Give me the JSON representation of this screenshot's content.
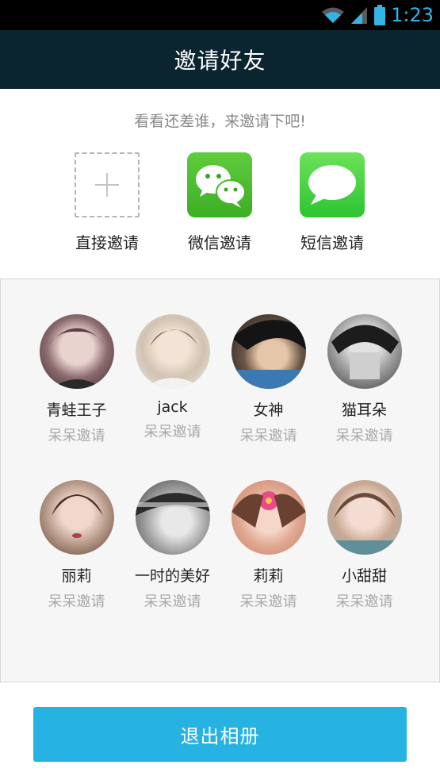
{
  "status_bar": {
    "time": "1:23",
    "icons": [
      "wifi-icon",
      "signal-icon",
      "battery-icon"
    ],
    "accent_color": "#33b5e5"
  },
  "header": {
    "title": "邀请好友",
    "background": "#0a2530"
  },
  "invite": {
    "hint": "看看还差谁，来邀请下吧!",
    "options": [
      {
        "label": "直接邀请",
        "icon": "plus-icon"
      },
      {
        "label": "微信邀请",
        "icon": "wechat-icon",
        "color": "#45b92c"
      },
      {
        "label": "短信邀请",
        "icon": "message-bubble-icon",
        "color": "#3ccf3b"
      }
    ]
  },
  "friends": [
    {
      "name": "青蛙王子",
      "status": "呆呆邀请",
      "avatar": "avatar-photo"
    },
    {
      "name": "jack",
      "status": "呆呆邀请",
      "avatar": "avatar-photo"
    },
    {
      "name": "女神",
      "status": "呆呆邀请",
      "avatar": "avatar-photo"
    },
    {
      "name": "猫耳朵",
      "status": "呆呆邀请",
      "avatar": "avatar-photo"
    },
    {
      "name": "丽莉",
      "status": "呆呆邀请",
      "avatar": "avatar-photo"
    },
    {
      "name": "一时的美好",
      "status": "呆呆邀请",
      "avatar": "avatar-photo"
    },
    {
      "name": "莉莉",
      "status": "呆呆邀请",
      "avatar": "avatar-photo"
    },
    {
      "name": "小甜甜",
      "status": "呆呆邀请",
      "avatar": "avatar-photo"
    }
  ],
  "footer": {
    "exit_label": "退出相册",
    "button_color": "#27b3e2"
  }
}
